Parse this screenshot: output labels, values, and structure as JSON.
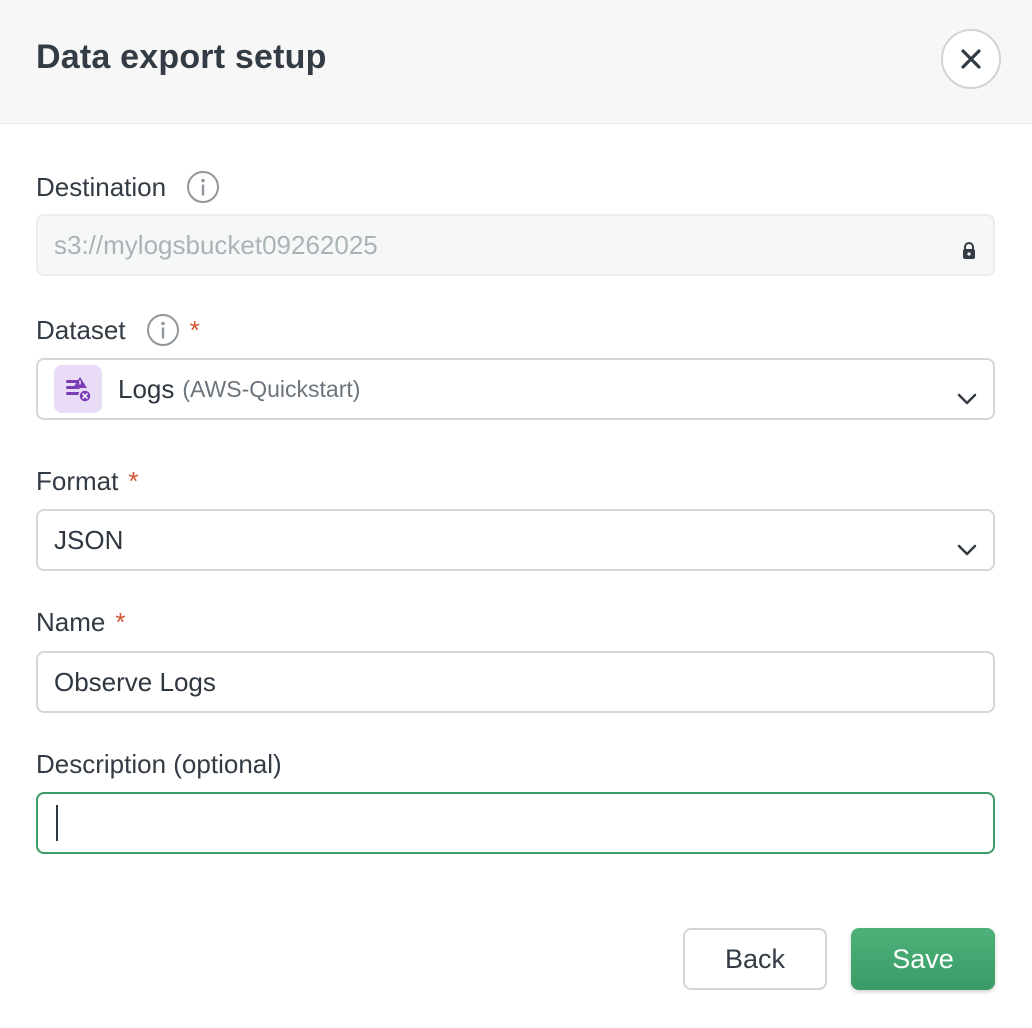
{
  "dialog": {
    "title": "Data export setup"
  },
  "destination": {
    "label": "Destination",
    "value": "s3://mylogsbucket09262025"
  },
  "dataset": {
    "label": "Dataset",
    "required_mark": "*",
    "name": "Logs",
    "source": "(AWS-Quickstart)"
  },
  "format": {
    "label": "Format",
    "required_mark": "*",
    "value": "JSON"
  },
  "name_field": {
    "label": "Name",
    "required_mark": "*",
    "value": "Observe Logs"
  },
  "description": {
    "label": "Description (optional)",
    "value": ""
  },
  "actions": {
    "back_label": "Back",
    "save_label": "Save"
  },
  "colors": {
    "primary": "#3c9b66",
    "required": "#d4532f",
    "dataset_icon_bg": "#e9dcf7",
    "dataset_icon_fg": "#7a3fb5"
  },
  "icons": {
    "close": "close-icon",
    "info": "info-icon",
    "lock": "lock-icon",
    "chevron": "chevron-down-icon",
    "dataset": "dataset-logs-icon"
  }
}
